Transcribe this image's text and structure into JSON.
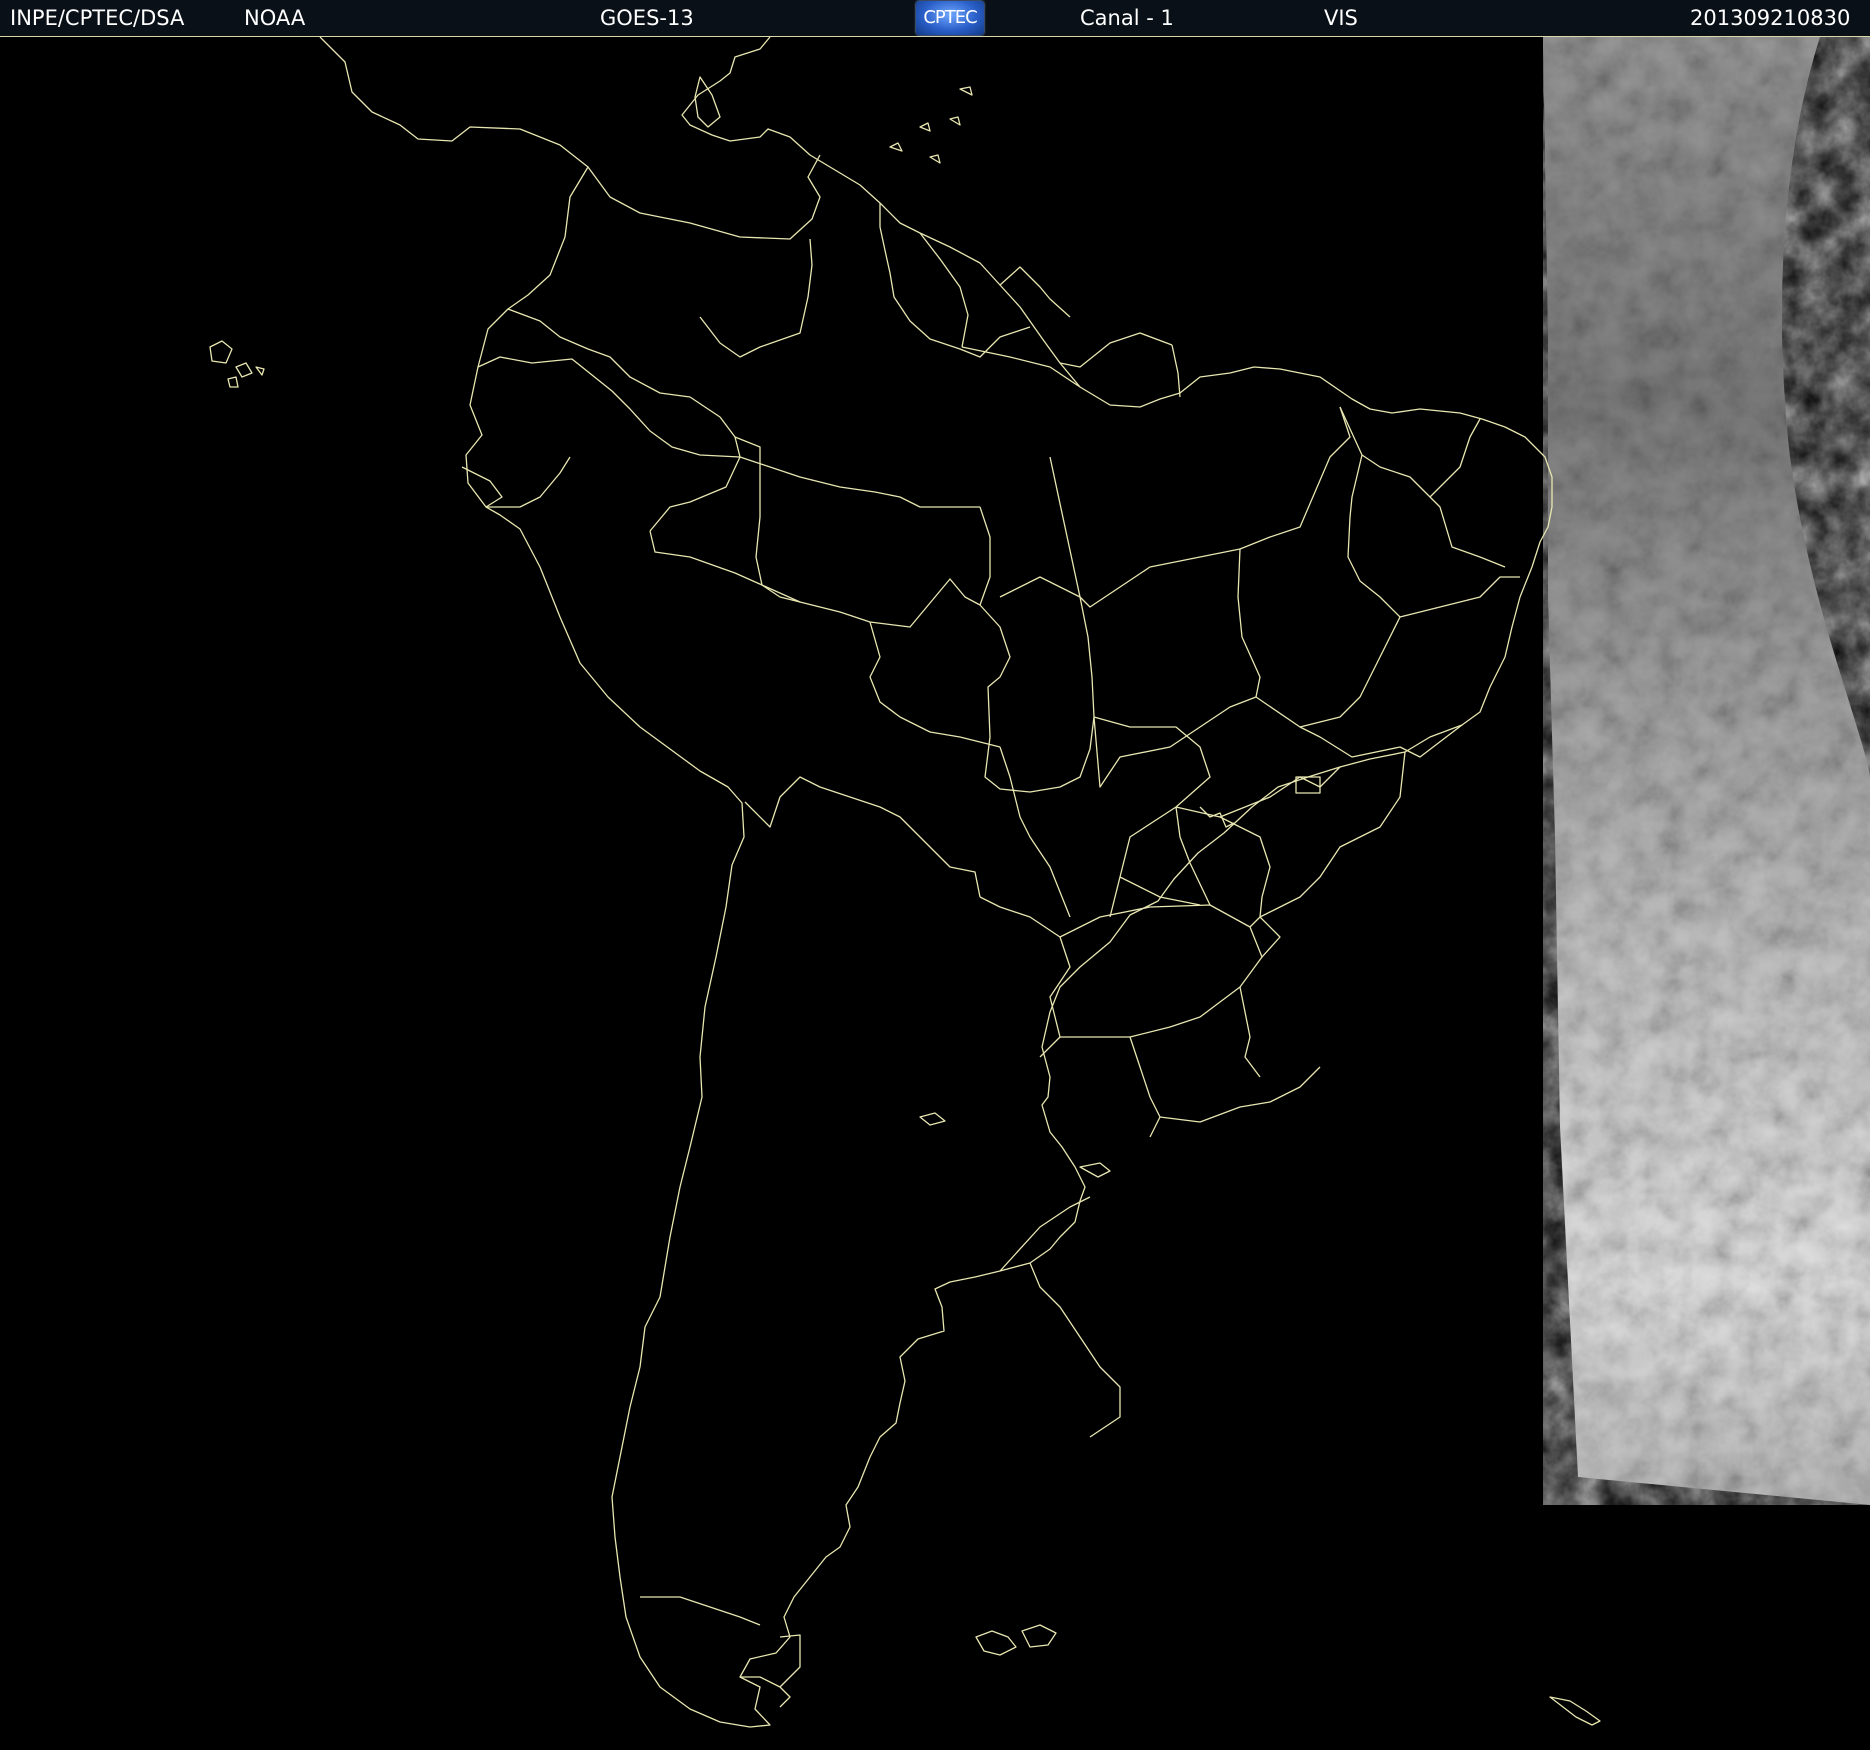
{
  "header": {
    "agency": "INPE/CPTEC/DSA",
    "source": "NOAA",
    "satellite": "GOES-13",
    "logo_text": "CPTEC",
    "channel": "Canal - 1",
    "band": "VIS",
    "timestamp": "201309210830"
  },
  "map": {
    "background_color": "#000000",
    "boundary_color": "#e8e6b0",
    "region": "South America"
  }
}
